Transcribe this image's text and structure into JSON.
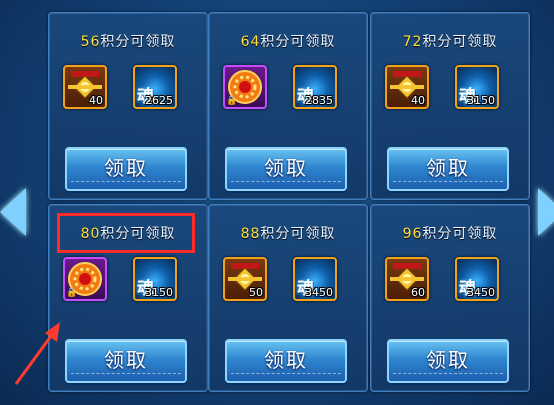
{
  "reward_cards": [
    {
      "points": "56",
      "suffix": "积分可领取",
      "items": [
        {
          "type": "emblem",
          "count": "40"
        },
        {
          "type": "soul",
          "glyph": "魂",
          "count": "2625"
        }
      ],
      "button": "领取"
    },
    {
      "points": "64",
      "suffix": "积分可领取",
      "items": [
        {
          "type": "wheel",
          "count": ""
        },
        {
          "type": "soul",
          "glyph": "魂",
          "count": "2835"
        }
      ],
      "button": "领取"
    },
    {
      "points": "72",
      "suffix": "积分可领取",
      "items": [
        {
          "type": "emblem",
          "count": "40"
        },
        {
          "type": "soul",
          "glyph": "魂",
          "count": "3150"
        }
      ],
      "button": "领取"
    },
    {
      "points": "80",
      "suffix": "积分可领取",
      "items": [
        {
          "type": "wheel",
          "count": ""
        },
        {
          "type": "soul",
          "glyph": "魂",
          "count": "3150"
        }
      ],
      "button": "领取"
    },
    {
      "points": "88",
      "suffix": "积分可领取",
      "items": [
        {
          "type": "emblem",
          "count": "50"
        },
        {
          "type": "soul",
          "glyph": "魂",
          "count": "3450"
        }
      ],
      "button": "领取"
    },
    {
      "points": "96",
      "suffix": "积分可领取",
      "items": [
        {
          "type": "emblem",
          "count": "60"
        },
        {
          "type": "soul",
          "glyph": "魂",
          "count": "3450"
        }
      ],
      "button": "领取"
    }
  ],
  "icons": {
    "emblem": "golden-emblem-icon",
    "wheel": "fire-wheel-icon",
    "soul": "soul-flame-icon",
    "lock": "lock-icon"
  },
  "colors": {
    "points": "#ffe03a",
    "highlight": "#ff2a2a",
    "arrow": "#ff3b2f"
  }
}
